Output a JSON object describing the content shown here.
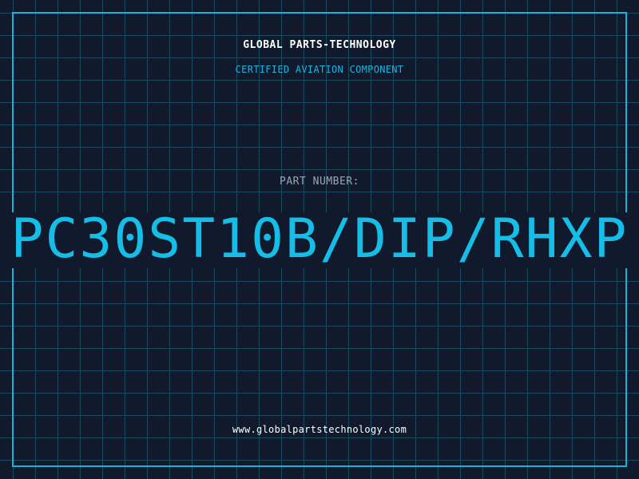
{
  "header": {
    "company": "GLOBAL PARTS-TECHNOLOGY",
    "subtitle": "CERTIFIED AVIATION COMPONENT"
  },
  "part": {
    "label": "PART NUMBER:",
    "number": "PC30ST10B/DIP/RHXP"
  },
  "footer": {
    "website": "www.globalpartstechnology.com"
  },
  "colors": {
    "background": "#101a2c",
    "grid": "#1c4a5e",
    "accent": "#16bde6",
    "label": "#9aa6b8",
    "text": "#ffffff"
  }
}
